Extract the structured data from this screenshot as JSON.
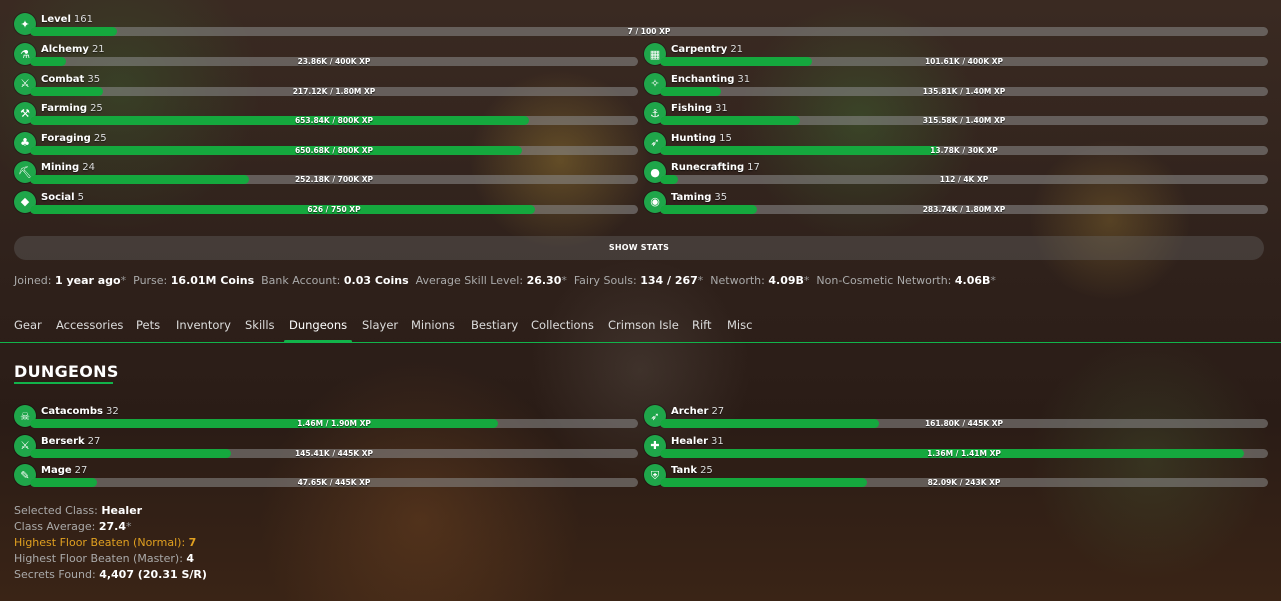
{
  "level": {
    "name": "Level",
    "level": "161",
    "xp": "7 / 100 XP",
    "progress": 0.07
  },
  "skills": [
    {
      "name": "Alchemy",
      "level": "21",
      "xp": "23.86K / 400K XP",
      "progress": 0.06,
      "icon": "alchemy-icon"
    },
    {
      "name": "Carpentry",
      "level": "21",
      "xp": "101.61K / 400K XP",
      "progress": 0.25,
      "icon": "carpentry-icon"
    },
    {
      "name": "Combat",
      "level": "35",
      "xp": "217.12K / 1.80M XP",
      "progress": 0.12,
      "icon": "combat-icon"
    },
    {
      "name": "Enchanting",
      "level": "31",
      "xp": "135.81K / 1.40M XP",
      "progress": 0.1,
      "icon": "enchanting-icon"
    },
    {
      "name": "Farming",
      "level": "25",
      "xp": "653.84K / 800K XP",
      "progress": 0.82,
      "icon": "farming-icon"
    },
    {
      "name": "Fishing",
      "level": "31",
      "xp": "315.58K / 1.40M XP",
      "progress": 0.23,
      "icon": "fishing-icon"
    },
    {
      "name": "Foraging",
      "level": "25",
      "xp": "650.68K / 800K XP",
      "progress": 0.81,
      "icon": "foraging-icon"
    },
    {
      "name": "Hunting",
      "level": "15",
      "xp": "13.78K / 30K XP",
      "progress": 0.46,
      "icon": "hunting-icon"
    },
    {
      "name": "Mining",
      "level": "24",
      "xp": "252.18K / 700K XP",
      "progress": 0.36,
      "icon": "mining-icon"
    },
    {
      "name": "Runecrafting",
      "level": "17",
      "xp": "112 / 4K XP",
      "progress": 0.03,
      "icon": "runecrafting-icon"
    },
    {
      "name": "Social",
      "level": "5",
      "xp": "626 / 750 XP",
      "progress": 0.83,
      "icon": "social-icon"
    },
    {
      "name": "Taming",
      "level": "35",
      "xp": "283.74K / 1.80M XP",
      "progress": 0.16,
      "icon": "taming-icon"
    }
  ],
  "show_stats": "SHOW STATS",
  "info": {
    "joined_label": "Joined:",
    "joined": "1 year ago",
    "purse_label": "Purse:",
    "purse": "16.01M Coins",
    "bank_label": "Bank Account:",
    "bank": "0.03 Coins",
    "avg_label": "Average Skill Level:",
    "avg": "26.30",
    "souls_label": "Fairy Souls:",
    "souls": "134 / 267",
    "nw_label": "Networth:",
    "nw": "4.09B",
    "ncnw_label": "Non-Cosmetic Networth:",
    "ncnw": "4.06B",
    "asterisk": "*"
  },
  "tabs": [
    "Gear",
    "Accessories",
    "Pets",
    "Inventory",
    "Skills",
    "Dungeons",
    "Slayer",
    "Minions",
    "Bestiary",
    "Collections",
    "Crimson Isle",
    "Rift",
    "Misc"
  ],
  "active_tab": "Dungeons",
  "section_title": "DUNGEONS",
  "dungeons": [
    {
      "name": "Catacombs",
      "level": "32",
      "xp": "1.46M / 1.90M XP",
      "progress": 0.77,
      "icon": "catacombs-icon"
    },
    {
      "name": "Archer",
      "level": "27",
      "xp": "161.80K / 445K XP",
      "progress": 0.36,
      "icon": "archer-icon"
    },
    {
      "name": "Berserk",
      "level": "27",
      "xp": "145.41K / 445K XP",
      "progress": 0.33,
      "icon": "berserk-icon"
    },
    {
      "name": "Healer",
      "level": "31",
      "xp": "1.36M / 1.41M XP",
      "progress": 0.96,
      "icon": "healer-icon"
    },
    {
      "name": "Mage",
      "level": "27",
      "xp": "47.65K / 445K XP",
      "progress": 0.11,
      "icon": "mage-icon"
    },
    {
      "name": "Tank",
      "level": "25",
      "xp": "82.09K / 243K XP",
      "progress": 0.34,
      "icon": "tank-icon"
    }
  ],
  "dungeon_stats": {
    "class_label": "Selected Class:",
    "class": "Healer",
    "avg_label": "Class Average:",
    "avg": "27.4",
    "normal_label": "Highest Floor Beaten (Normal):",
    "normal": "7",
    "master_label": "Highest Floor Beaten (Master):",
    "master": "4",
    "secrets_label": "Secrets Found:",
    "secrets": "4,407 (20.31 S/R)"
  }
}
